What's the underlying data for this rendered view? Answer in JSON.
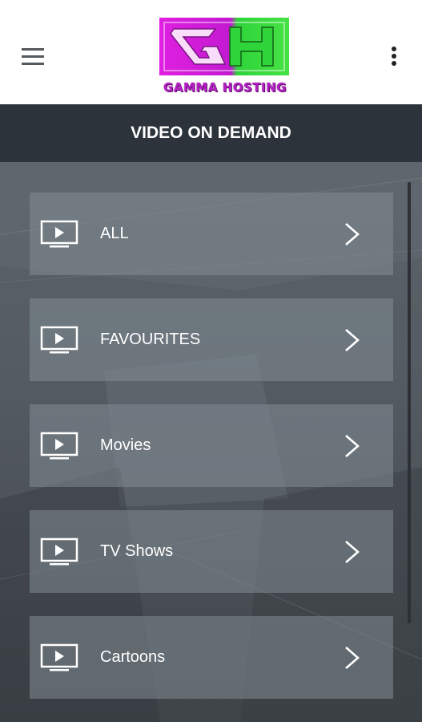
{
  "app": {
    "brand": "GAMMA HOSTING",
    "logo_letters": "GH",
    "colors": {
      "brand_magenta": "#d41fd8",
      "brand_green": "#3ddc3a",
      "header_bg": "#2c333a",
      "tile_bg": "#7d878f"
    }
  },
  "topbar": {
    "menu_icon": "hamburger-menu-icon",
    "overflow_icon": "more-vert-icon"
  },
  "page": {
    "title": "VIDEO ON DEMAND"
  },
  "menu": {
    "items": [
      {
        "label": "ALL",
        "icon": "tv-play-icon",
        "arrow": "chevron-right-icon"
      },
      {
        "label": "FAVOURITES",
        "icon": "tv-play-icon",
        "arrow": "chevron-right-icon"
      },
      {
        "label": "Movies",
        "icon": "tv-play-icon",
        "arrow": "chevron-right-icon"
      },
      {
        "label": "TV Shows",
        "icon": "tv-play-icon",
        "arrow": "chevron-right-icon"
      },
      {
        "label": "Cartoons",
        "icon": "tv-play-icon",
        "arrow": "chevron-right-icon"
      }
    ]
  }
}
